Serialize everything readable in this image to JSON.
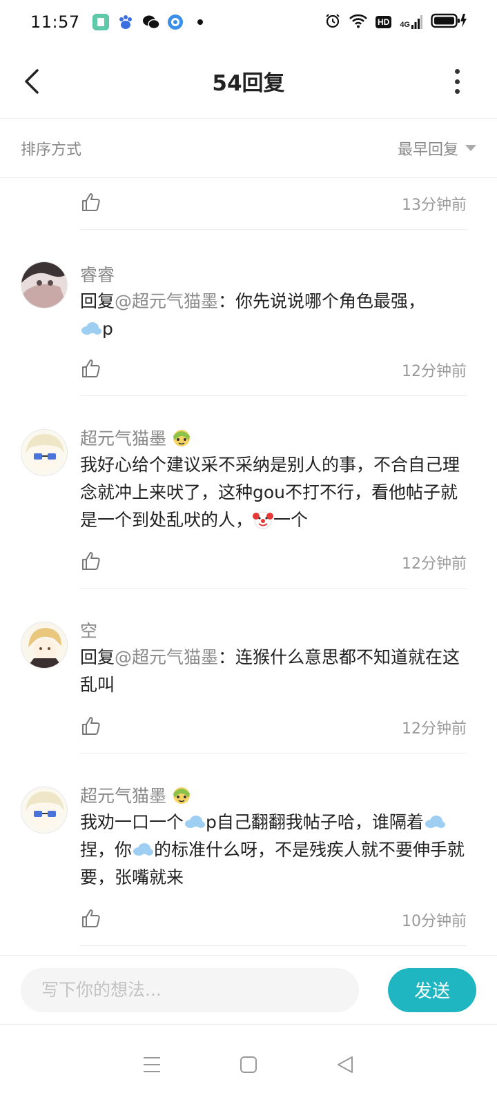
{
  "status": {
    "time": "11:57",
    "network": "4G"
  },
  "header": {
    "title": "54回复"
  },
  "sort": {
    "label": "排序方式",
    "value": "最早回复"
  },
  "comments": [
    {
      "time": "13分钟前"
    },
    {
      "author": "睿睿",
      "reply_prefix": "回复",
      "mention": "@超元气猫墨",
      "text_a": "：你先说说哪个角色最强，",
      "text_b": "p",
      "time": "12分钟前"
    },
    {
      "author": "超元气猫墨",
      "text_a": "我好心给个建议采不采纳是别人的事，不合自己理念就冲上来吠了，这种gou不打不行，看他帖子就是一个到处乱吠的人，",
      "text_b": "一个",
      "time": "12分钟前"
    },
    {
      "author": "空",
      "reply_prefix": "回复",
      "mention": "@超元气猫墨",
      "text_a": "：连猴什么意思都不知道就在这乱叫",
      "time": "12分钟前"
    },
    {
      "author": "超元气猫墨",
      "text_a": "我劝一口一个",
      "text_b": "p自己翻翻我帖子哈，谁隔着",
      "text_c": "捏，你",
      "text_d": "的标准什么呀，不是残疾人就不要伸手就要，张嘴就来",
      "time": "10分钟前"
    }
  ],
  "compose": {
    "placeholder": "写下你的想法...",
    "send_label": "发送"
  },
  "colors": {
    "accent": "#1fb6c1",
    "muted_text": "#888888",
    "divider": "#ececec"
  }
}
